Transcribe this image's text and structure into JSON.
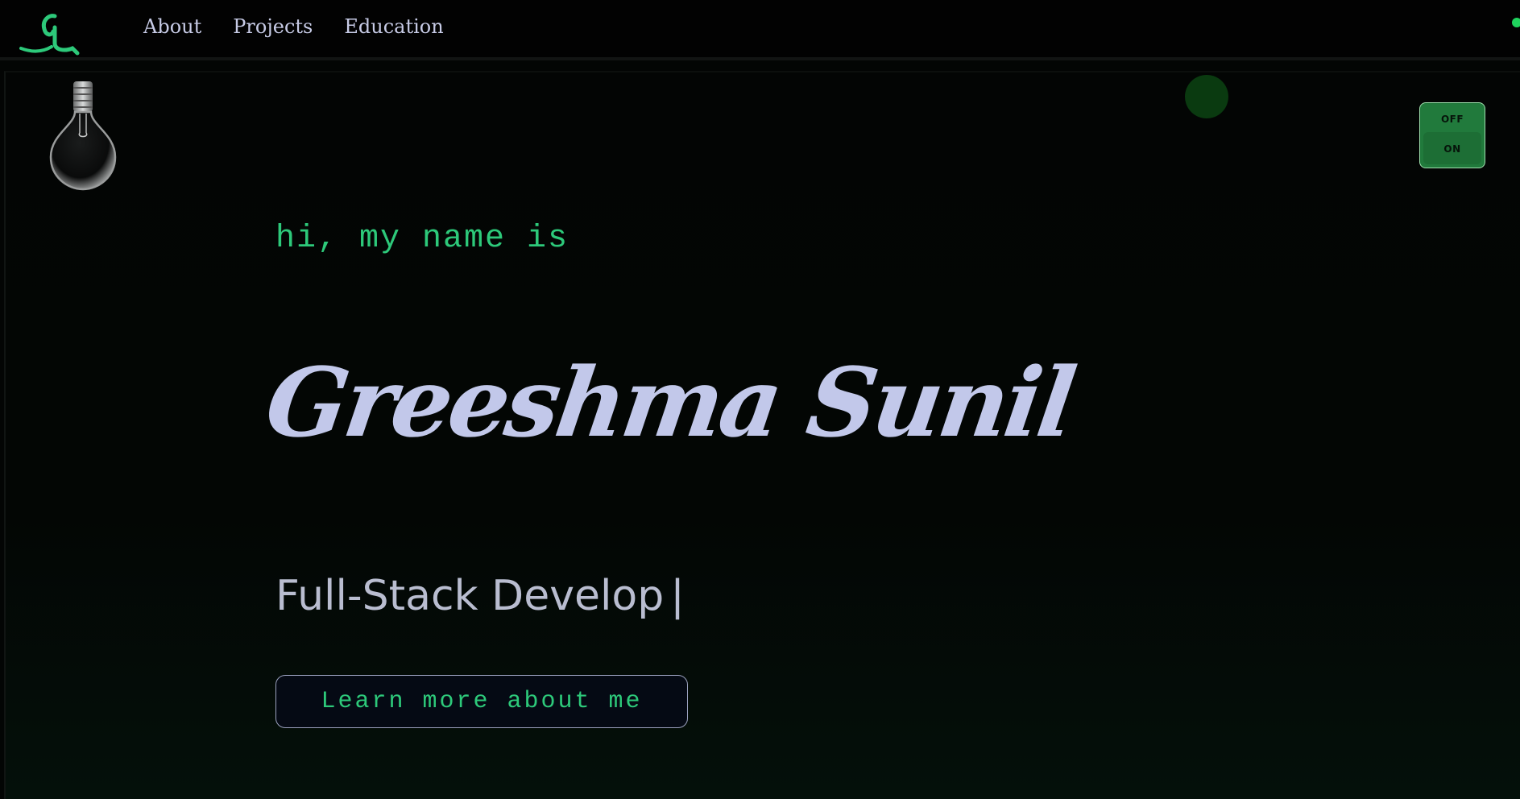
{
  "navbar": {
    "logo_alt": "GS logo",
    "links": [
      {
        "label": "About"
      },
      {
        "label": "Projects"
      },
      {
        "label": "Education"
      }
    ]
  },
  "hero": {
    "intro": "hi, my name is",
    "name": "Greeshma Sunil",
    "role": "Full-Stack Develop",
    "cursor": "|",
    "cta_label": "Learn more about me"
  },
  "toggle": {
    "off_label": "OFF",
    "on_label": "ON",
    "state": "on"
  },
  "colors": {
    "accent_green": "#2dc97a",
    "name_color": "#c2c8ea",
    "toggle_green": "#217a3c",
    "background": "#030504"
  },
  "icons": {
    "logo": "gs-monogram-logo",
    "bulb": "light-bulb-icon"
  }
}
